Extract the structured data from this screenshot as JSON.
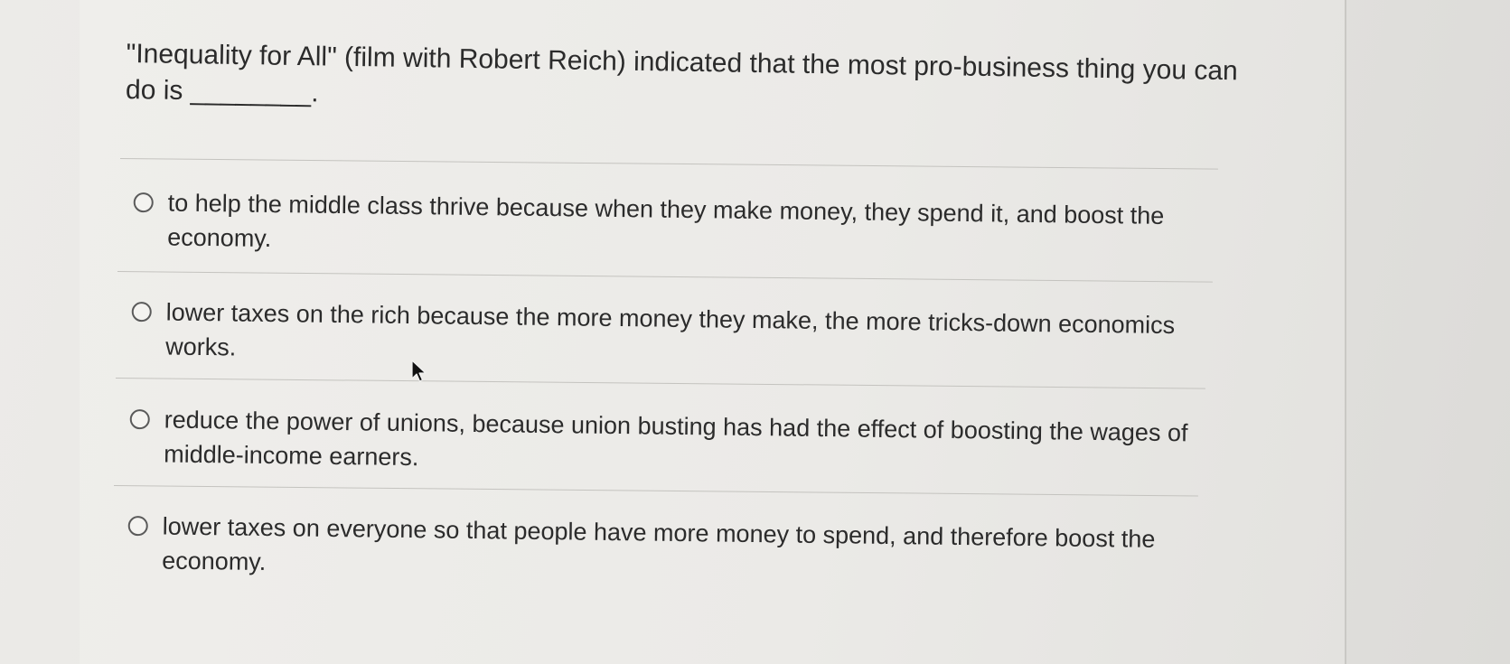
{
  "question": {
    "text": "\"Inequality for All\" (film with Robert Reich) indicated that the most pro-business thing you can do is ________."
  },
  "options": [
    {
      "label": "to help the middle class thrive because when they make money, they spend it, and boost the economy."
    },
    {
      "label": "lower taxes on the rich because the more money they make, the more tricks-down economics works."
    },
    {
      "label": "reduce the power of unions, because union busting has had the effect of boosting the wages of middle-income earners."
    },
    {
      "label": "lower taxes on everyone so that people have more money to spend, and therefore boost the economy."
    }
  ],
  "icons": {
    "cursor": "mouse-pointer-icon",
    "radio": "radio-button-unselected"
  },
  "colors": {
    "background": "#e9e7e4",
    "text": "#2b2b2b",
    "divider": "#c4c3bf"
  }
}
